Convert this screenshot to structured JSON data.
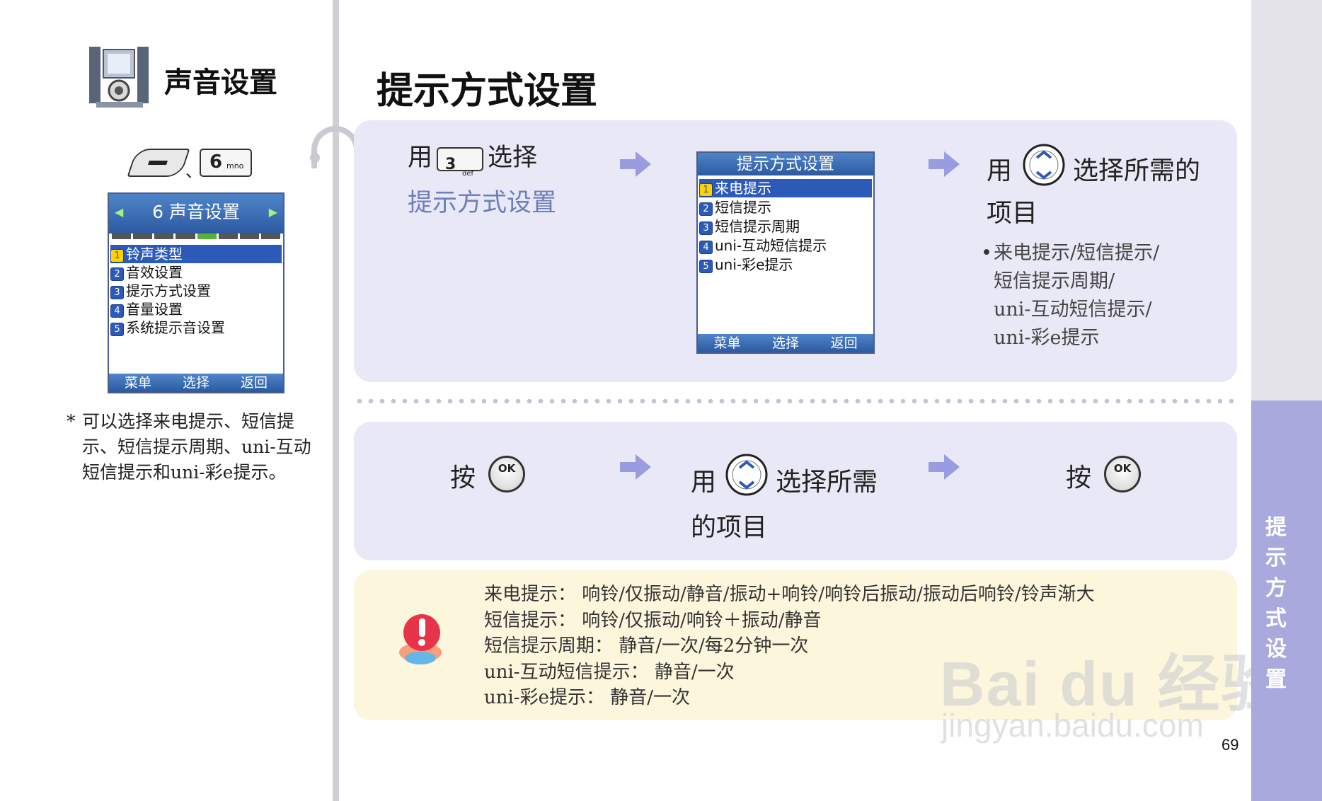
{
  "sidebar": {
    "section_title": "声音设置",
    "key_separator": "、",
    "key6": {
      "num": "6",
      "sub": "mno"
    },
    "phone": {
      "header": "6 声音设置",
      "items": [
        {
          "num": "1",
          "label": "铃声类型"
        },
        {
          "num": "2",
          "label": "音效设置"
        },
        {
          "num": "3",
          "label": "提示方式设置"
        },
        {
          "num": "4",
          "label": "音量设置"
        },
        {
          "num": "5",
          "label": "系统提示音设置"
        }
      ],
      "softkeys": [
        "菜单",
        "选择",
        "返回"
      ]
    },
    "note_star": "*",
    "note": "可以选择来电提示、短信提示、短信提示周期、uni-互动短信提示和uni-彩e提示。"
  },
  "page_title": "提示方式设置",
  "step1": {
    "use": "用",
    "key3": {
      "num": "3",
      "sub": "def"
    },
    "select": "选择",
    "target": "提示方式设置"
  },
  "step2": {
    "phone": {
      "header": "提示方式设置",
      "items": [
        {
          "num": "1",
          "label": "来电提示"
        },
        {
          "num": "2",
          "label": "短信提示"
        },
        {
          "num": "3",
          "label": "短信提示周期"
        },
        {
          "num": "4",
          "label": "uni-互动短信提示"
        },
        {
          "num": "5",
          "label": "uni-彩e提示"
        }
      ],
      "softkeys": [
        "菜单",
        "选择",
        "返回"
      ]
    }
  },
  "step3": {
    "use": "用",
    "line1": "选择所需的",
    "line2": "项目",
    "bullet": "•",
    "options": [
      "来电提示/短信提示/",
      "短信提示周期/",
      "uni-互动短信提示/",
      "uni-彩e提示"
    ]
  },
  "row2": {
    "press": "按",
    "ok_label": "OK",
    "use": "用",
    "line1": "选择所需",
    "line2": "的项目",
    "press2": "按"
  },
  "warning": {
    "lines": [
      "来电提示： 响铃/仅振动/静音/振动+响铃/响铃后振动/振动后响铃/铃声渐大",
      "短信提示： 响铃/仅振动/响铃＋振动/静音",
      "短信提示周期： 静音/一次/每2分钟一次",
      "uni-互动短信提示： 静音/一次",
      "uni-彩e提示： 静音/一次"
    ]
  },
  "side_tab": {
    "chars": [
      "提",
      "示",
      "方",
      "式",
      "设",
      "置"
    ]
  },
  "page_number": "69",
  "watermark": {
    "main": "Bai du 经验",
    "url": "jingyan.baidu.com"
  },
  "colors": {
    "panel": "#e8e8f6",
    "warning_panel": "#fcf6dc",
    "accent_blue": "#2c5ab8",
    "side_tab": "#a9a9dd",
    "arrow": "#9b9be0"
  }
}
